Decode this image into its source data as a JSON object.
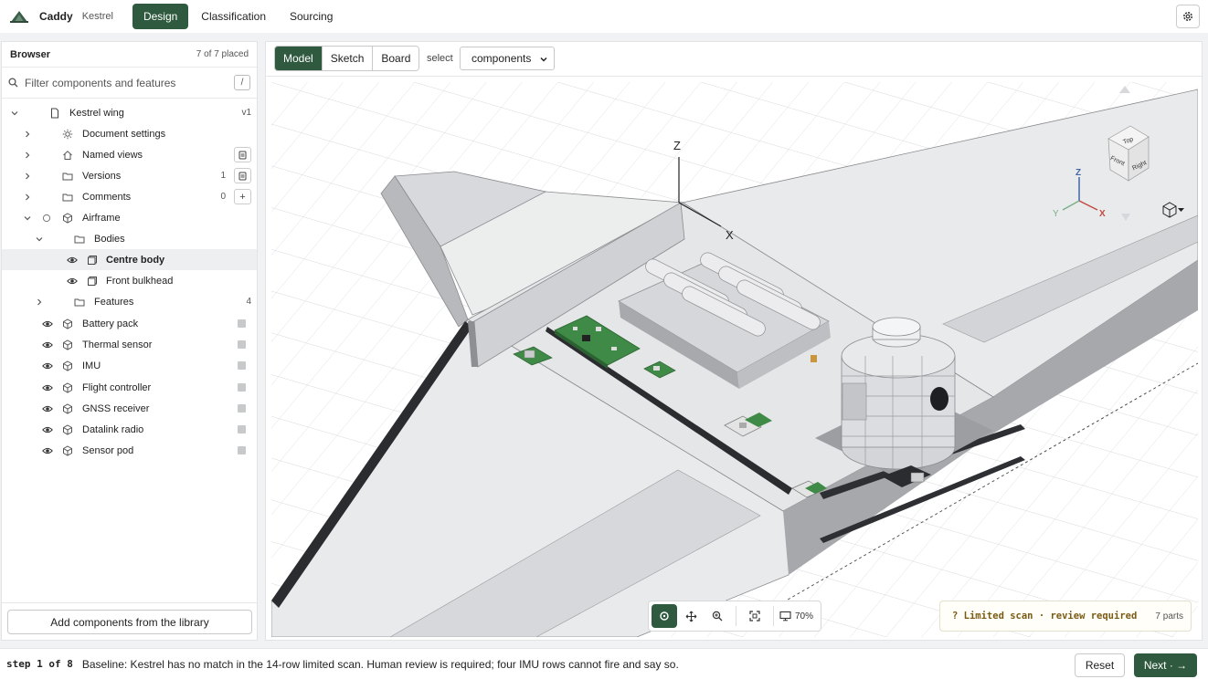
{
  "app": {
    "name": "Caddy",
    "project": "Kestrel"
  },
  "tabs": [
    {
      "label": "Design",
      "active": true
    },
    {
      "label": "Classification",
      "active": false
    },
    {
      "label": "Sourcing",
      "active": false
    }
  ],
  "sidebar": {
    "title": "Browser",
    "count": "7 of 7 placed",
    "filter_placeholder": "Filter components and features",
    "filter_shortcut": "/",
    "root": {
      "label": "Kestrel wing",
      "version": "v1"
    },
    "items": [
      {
        "label": "Document settings"
      },
      {
        "label": "Named views"
      },
      {
        "label": "Versions",
        "count": "1"
      },
      {
        "label": "Comments",
        "count": "0",
        "action": "+"
      },
      {
        "label": "Airframe"
      },
      {
        "label": "Bodies"
      },
      {
        "label": "Centre body"
      },
      {
        "label": "Front bulkhead"
      },
      {
        "label": "Features",
        "count": "4"
      }
    ],
    "components": [
      {
        "label": "Battery pack"
      },
      {
        "label": "Thermal sensor"
      },
      {
        "label": "IMU"
      },
      {
        "label": "Flight controller"
      },
      {
        "label": "GNSS receiver"
      },
      {
        "label": "Datalink radio"
      },
      {
        "label": "Sensor pod"
      }
    ],
    "add_button": "Add components from the library"
  },
  "viewport": {
    "modes": [
      "Model",
      "Sketch",
      "Board"
    ],
    "active_mode": "Model",
    "select_label": "select",
    "select_value": "components",
    "axes": {
      "z": "Z",
      "x": "X",
      "y": "Y"
    },
    "view_cube": {
      "top": "Top",
      "front": "Front",
      "right": "Right"
    },
    "zoom": "70%",
    "scan_status": "? Limited scan · review required",
    "scan_parts": "7 parts"
  },
  "footer": {
    "step": "step 1 of 8",
    "message": "Baseline: Kestrel has no match in the 14-row limited scan. Human review is required; four IMU rows cannot fire and say so.",
    "reset": "Reset",
    "next": "Next · →"
  },
  "colors": {
    "accent": "#2f5a3f",
    "warning_text": "#7a5a12",
    "pcb": "#3f8a46"
  }
}
